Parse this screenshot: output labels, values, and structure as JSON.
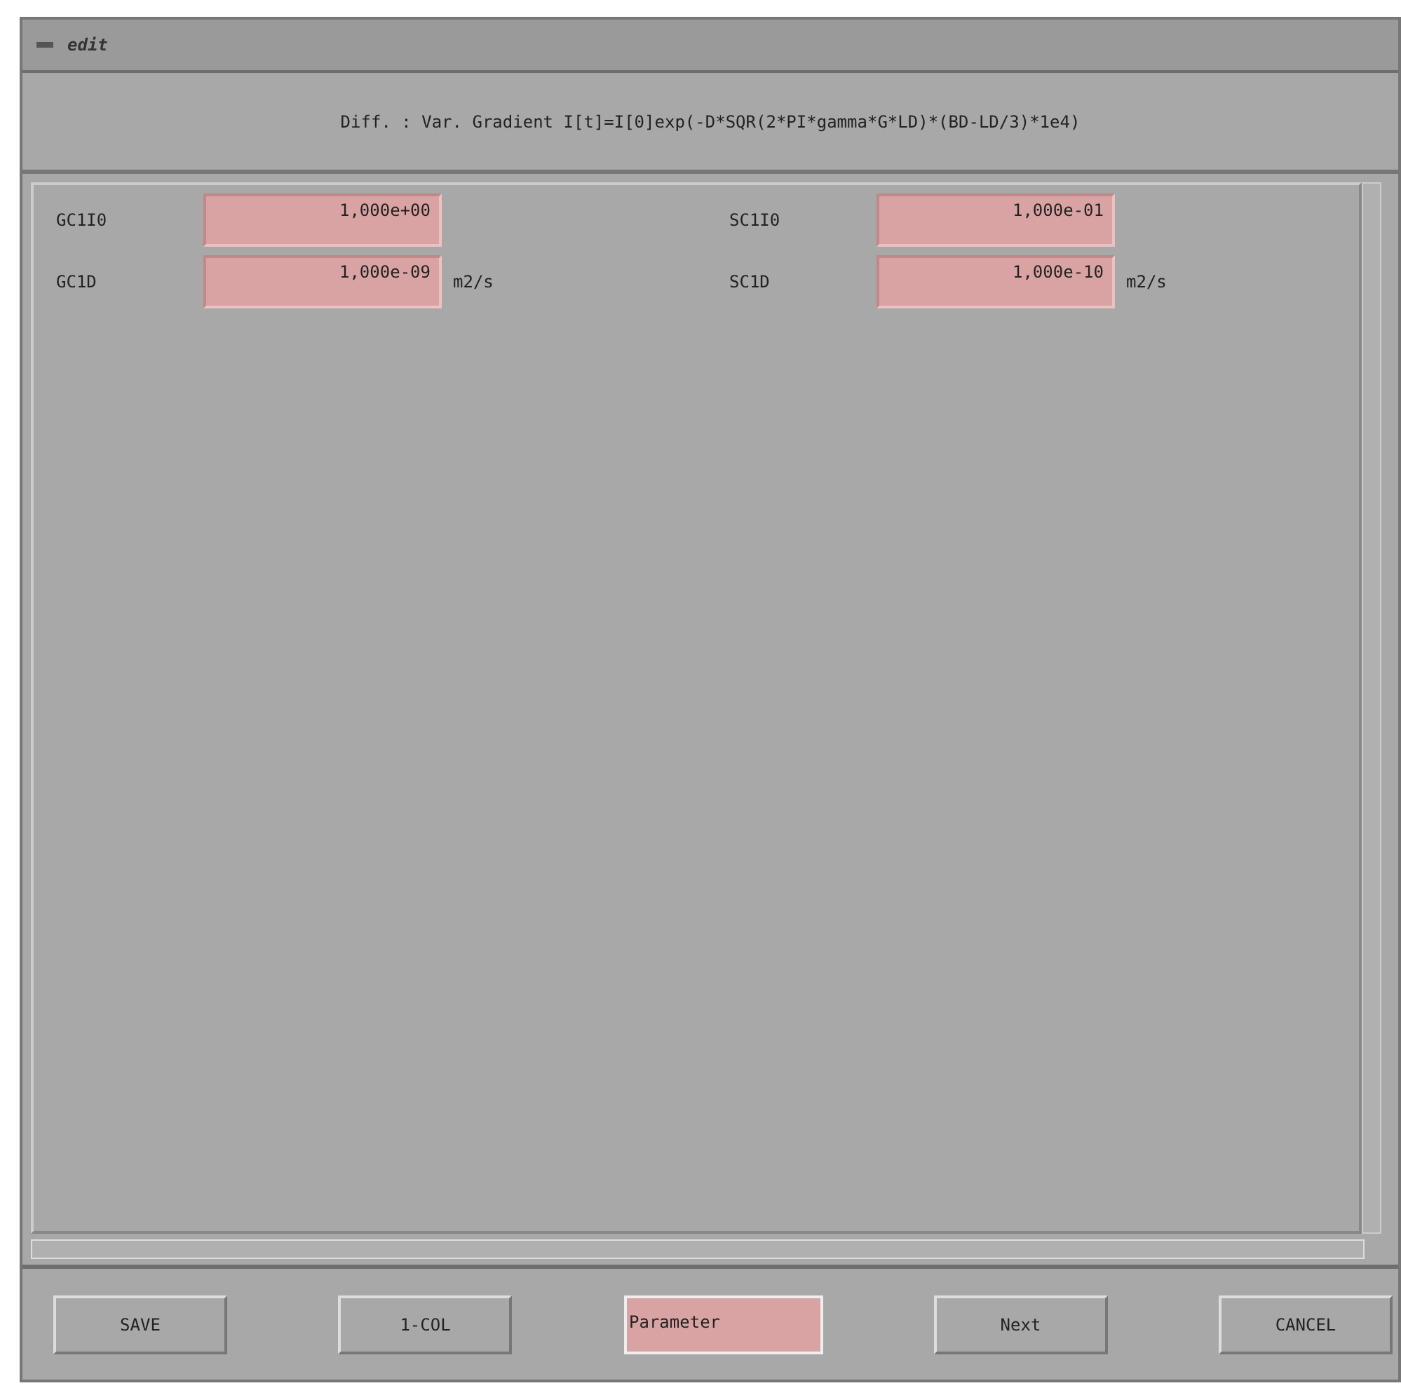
{
  "window": {
    "title": "edit"
  },
  "formula": "Diff. : Var. Gradient I[t]=I[0]exp(-D*SQR(2*PI*gamma*G*LD)*(BD-LD/3)*1e4)",
  "fields": [
    {
      "label": "GC1I0",
      "value": "1,000e+00"
    },
    {
      "label": "SC1I0",
      "value": "1,000e-01"
    },
    {
      "label": "GC1D",
      "value": "1,000e-09",
      "unit": "m2/s"
    },
    {
      "label": "SC1D",
      "value": "1,000e-10",
      "unit": "m2/s"
    }
  ],
  "buttons": [
    {
      "label": "SAVE",
      "kind": "button"
    },
    {
      "label": "1-COL",
      "kind": "button"
    },
    {
      "label": "Parameter",
      "kind": "field"
    },
    {
      "label": "Next",
      "kind": "button"
    },
    {
      "label": "CANCEL",
      "kind": "button"
    }
  ]
}
